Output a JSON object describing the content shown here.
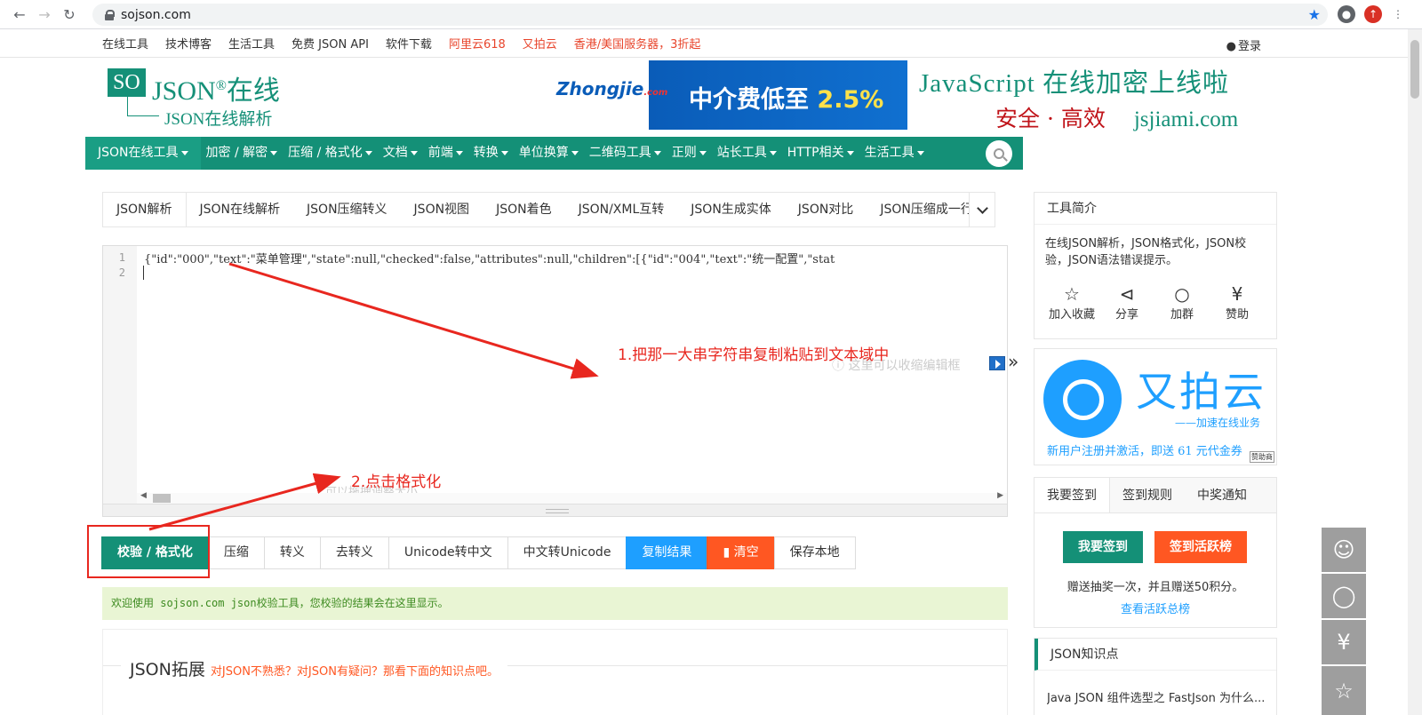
{
  "browser": {
    "url": "sojson.com"
  },
  "topnav": {
    "items": [
      "在线工具",
      "技术博客",
      "生活工具",
      "免费 JSON API",
      "软件下载"
    ],
    "red_items": [
      "阿里云618",
      "又拍云",
      "香港/美国服务器，3折起"
    ],
    "login": "登录"
  },
  "logo": {
    "so": "SO",
    "json": "JSON",
    "reg": "®",
    "zai": "在线",
    "sub": "JSON在线解析"
  },
  "ad1": {
    "brand": "Zhongjie",
    "brand_sub": ".com",
    "text": "中介费低至",
    "pct": "2.5%"
  },
  "ad2": {
    "line1": "JavaScript 在线加密上线啦",
    "line2": "安全 · 高效",
    "domain": "jsjiami.com"
  },
  "mainnav": [
    "JSON在线工具",
    "加密 / 解密",
    "压缩 / 格式化",
    "文档",
    "前端",
    "转换",
    "单位换算",
    "二维码工具",
    "正则",
    "站长工具",
    "HTTP相关",
    "生活工具"
  ],
  "tabs": [
    "JSON解析",
    "JSON在线解析",
    "JSON压缩转义",
    "JSON视图",
    "JSON着色",
    "JSON/XML互转",
    "JSON生成实体",
    "JSON对比",
    "JSON压缩成一行"
  ],
  "editor": {
    "line_numbers": [
      "1",
      "2"
    ],
    "code": "{\"id\":\"000\",\"text\":\"菜单管理\",\"state\":null,\"checked\":false,\"attributes\":null,\"children\":[{\"id\":\"004\",\"text\":\"统一配置\",\"stat",
    "hint_collapse": "这里可以收缩编辑框",
    "hint_resize": "可以拖拽调整大小"
  },
  "annotations": {
    "a1": "1.把那一大串字符串复制粘贴到文本域中",
    "a2": "2.点击格式化"
  },
  "buttons": {
    "format": "校验 / 格式化",
    "compress": "压缩",
    "escape": "转义",
    "unescape": "去转义",
    "unicode_to_cn": "Unicode转中文",
    "cn_to_unicode": "中文转Unicode",
    "copy": "复制结果",
    "clear": "清空",
    "save": "保存本地"
  },
  "result_text": "欢迎使用 sojson.com json校验工具，您校验的结果会在这里显示。",
  "ext": {
    "title": "JSON拓展",
    "sub": "对JSON不熟悉？对JSON有疑问？那看下面的知识点吧。"
  },
  "side": {
    "intro_title": "工具简介",
    "intro_text": "在线JSON解析，JSON格式化，JSON校验，JSON语法错误提示。",
    "actions": [
      {
        "icon": "star-icon",
        "label": "加入收藏"
      },
      {
        "icon": "share-icon",
        "label": "分享"
      },
      {
        "icon": "qq-icon",
        "label": "加群"
      },
      {
        "icon": "yen-icon",
        "label": "赞助"
      }
    ],
    "upyun": {
      "name": "又拍云",
      "slogan": "——加速在线业务",
      "bottom": "新用户注册并激活，即送 61 元代金券",
      "mark": "赞助商"
    },
    "sign_tabs": [
      "我要签到",
      "签到规则",
      "中奖通知"
    ],
    "sign_btn": "我要签到",
    "rank_btn": "签到活跃榜",
    "sign_text": "赠送抽奖一次，并且赠送50积分。",
    "sign_link": "查看活跃总榜",
    "know_title": "JSON知识点",
    "know_item": "Java JSON 组件选型之 FastJson 为什么..."
  },
  "colors": {
    "primary": "#149077",
    "blue": "#1e9fff",
    "orange": "#ff5722",
    "annotation": "#e8271f"
  }
}
